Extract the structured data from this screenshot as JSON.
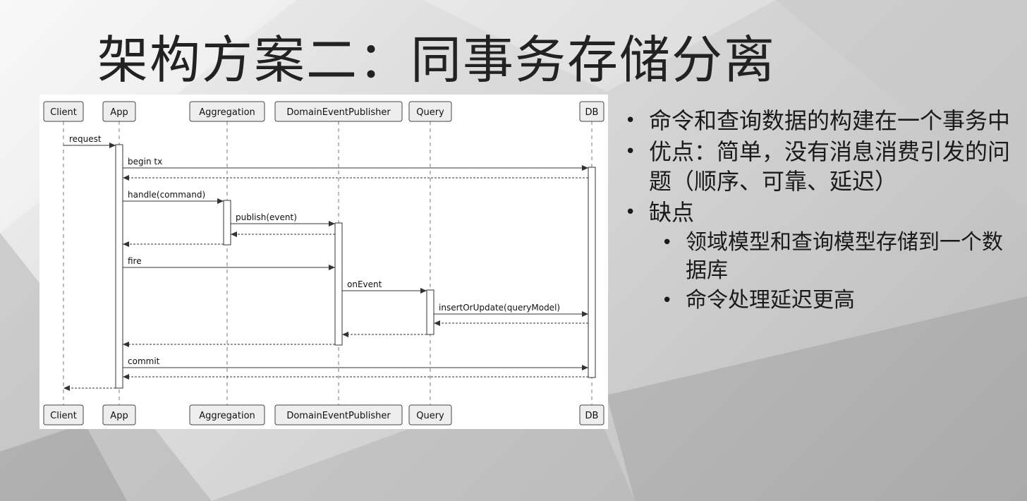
{
  "title": "架构方案二：同事务存储分离",
  "diagram": {
    "participants": [
      "Client",
      "App",
      "Aggregation",
      "DomainEventPublisher",
      "Query",
      "DB"
    ],
    "messages": [
      {
        "from": 0,
        "to": 1,
        "label": "request",
        "dashed": false
      },
      {
        "from": 1,
        "to": 5,
        "label": "begin tx",
        "dashed": false
      },
      {
        "from": 5,
        "to": 1,
        "label": "",
        "dashed": true
      },
      {
        "from": 1,
        "to": 2,
        "label": "handle(command)",
        "dashed": false
      },
      {
        "from": 2,
        "to": 3,
        "label": "publish(event)",
        "dashed": false
      },
      {
        "from": 3,
        "to": 2,
        "label": "",
        "dashed": true
      },
      {
        "from": 2,
        "to": 1,
        "label": "",
        "dashed": true
      },
      {
        "from": 1,
        "to": 3,
        "label": "fire",
        "dashed": false
      },
      {
        "from": 3,
        "to": 4,
        "label": "onEvent",
        "dashed": false
      },
      {
        "from": 4,
        "to": 5,
        "label": "insertOrUpdate(queryModel)",
        "dashed": false
      },
      {
        "from": 5,
        "to": 4,
        "label": "",
        "dashed": true
      },
      {
        "from": 4,
        "to": 3,
        "label": "",
        "dashed": true
      },
      {
        "from": 3,
        "to": 1,
        "label": "",
        "dashed": true
      },
      {
        "from": 1,
        "to": 5,
        "label": "commit",
        "dashed": false
      },
      {
        "from": 5,
        "to": 1,
        "label": "",
        "dashed": true
      },
      {
        "from": 1,
        "to": 0,
        "label": "",
        "dashed": true
      }
    ]
  },
  "bullets": [
    {
      "text": "命令和查询数据的构建在一个事务中",
      "level": 1
    },
    {
      "text": "优点：简单，没有消息消费引发的问题（顺序、可靠、延迟）",
      "level": 1
    },
    {
      "text": "缺点",
      "level": 1
    },
    {
      "text": "领域模型和查询模型存储到一个数据库",
      "level": 2
    },
    {
      "text": "命令处理延迟更高",
      "level": 2
    }
  ],
  "colors": {
    "participant_fill": "#eeeeee",
    "participant_border": "#444444",
    "line": "#333333"
  }
}
